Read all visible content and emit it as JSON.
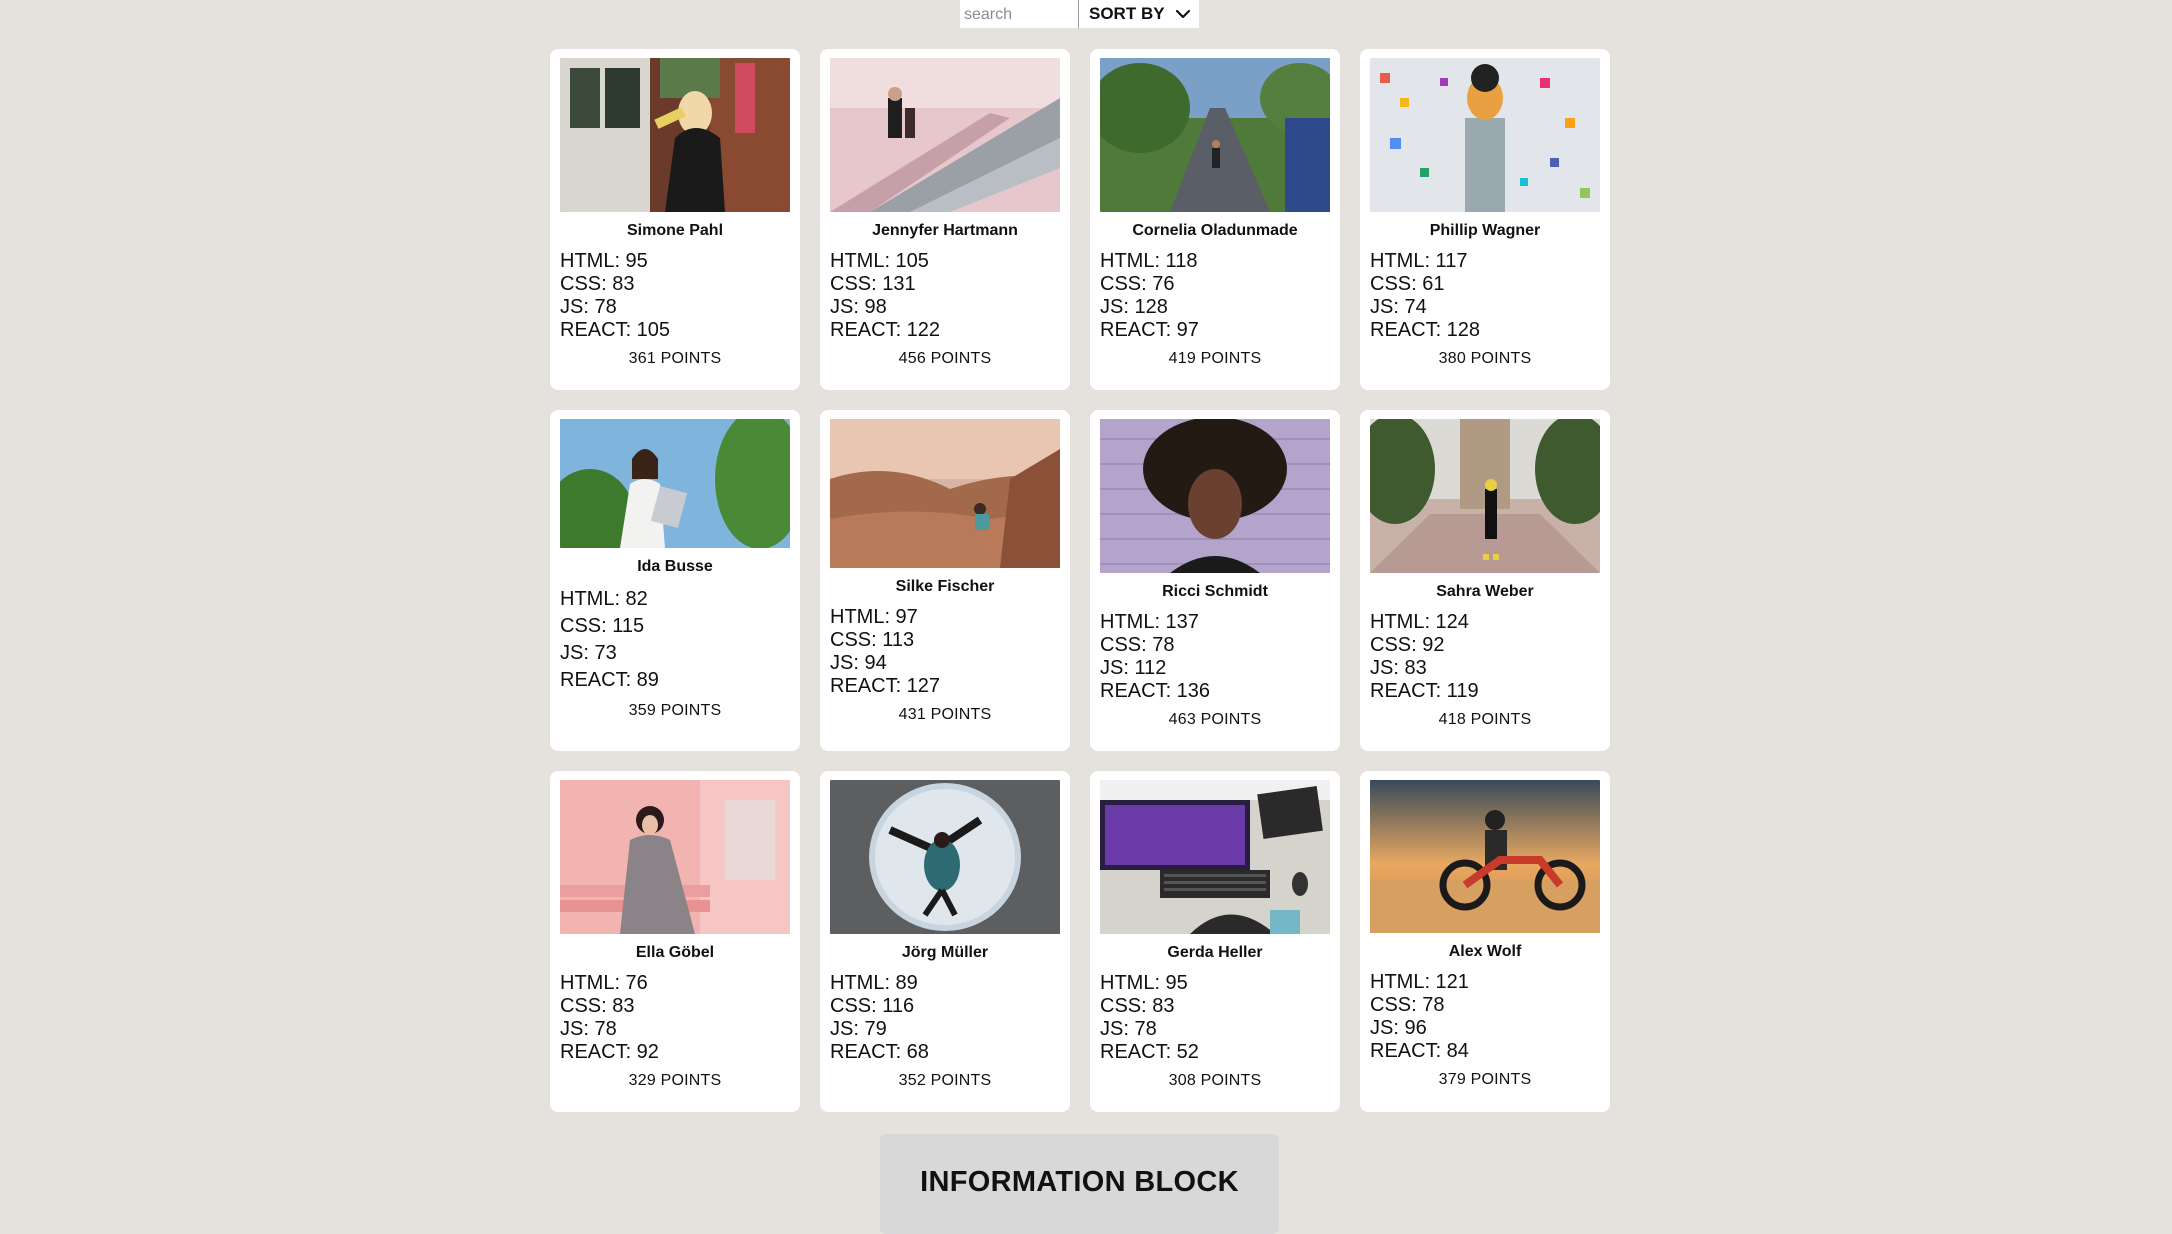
{
  "toolbar": {
    "search_placeholder": "search",
    "sort_label": "SORT BY",
    "sort_icon": "chevron-down-icon"
  },
  "cards": [
    {
      "name": "Simone Pahl",
      "html": "HTML: 95",
      "css": "CSS: 83",
      "js": "JS: 78",
      "react": "REACT: 105",
      "points": "361 POINTS"
    },
    {
      "name": "Jennyfer Hartmann",
      "html": "HTML: 105",
      "css": "CSS: 131",
      "js": "JS: 98",
      "react": "REACT: 122",
      "points": "456 POINTS"
    },
    {
      "name": "Cornelia Oladunmade",
      "html": "HTML: 118",
      "css": "CSS: 76",
      "js": "JS: 128",
      "react": "REACT: 97",
      "points": "419 POINTS"
    },
    {
      "name": "Phillip Wagner",
      "html": "HTML: 117",
      "css": "CSS: 61",
      "js": "JS: 74",
      "react": "REACT: 128",
      "points": "380 POINTS"
    },
    {
      "name": "Ida Busse",
      "html": "HTML: 82",
      "css": "CSS: 115",
      "js": "JS: 73",
      "react": "REACT: 89",
      "points": "359 POINTS"
    },
    {
      "name": "Silke Fischer",
      "html": "HTML: 97",
      "css": "CSS: 113",
      "js": "JS: 94",
      "react": "REACT: 127",
      "points": "431 POINTS"
    },
    {
      "name": "Ricci Schmidt",
      "html": "HTML: 137",
      "css": "CSS: 78",
      "js": "JS: 112",
      "react": "REACT: 136",
      "points": "463 POINTS"
    },
    {
      "name": "Sahra Weber",
      "html": "HTML: 124",
      "css": "CSS: 92",
      "js": "JS: 83",
      "react": "REACT: 119",
      "points": "418 POINTS"
    },
    {
      "name": "Ella Göbel",
      "html": "HTML: 76",
      "css": "CSS: 83",
      "js": "JS: 78",
      "react": "REACT: 92",
      "points": "329 POINTS"
    },
    {
      "name": "Jörg Müller",
      "html": "HTML: 89",
      "css": "CSS: 116",
      "js": "JS: 79",
      "react": "REACT: 68",
      "points": "352 POINTS"
    },
    {
      "name": "Gerda Heller",
      "html": "HTML: 95",
      "css": "CSS: 83",
      "js": "JS: 78",
      "react": "REACT: 52",
      "points": "308 POINTS"
    },
    {
      "name": "Alex Wolf",
      "html": "HTML: 121",
      "css": "CSS: 78",
      "js": "JS: 96",
      "react": "REACT: 84",
      "points": "379 POINTS"
    }
  ],
  "info_block": {
    "title": "INFORMATION BLOCK"
  }
}
